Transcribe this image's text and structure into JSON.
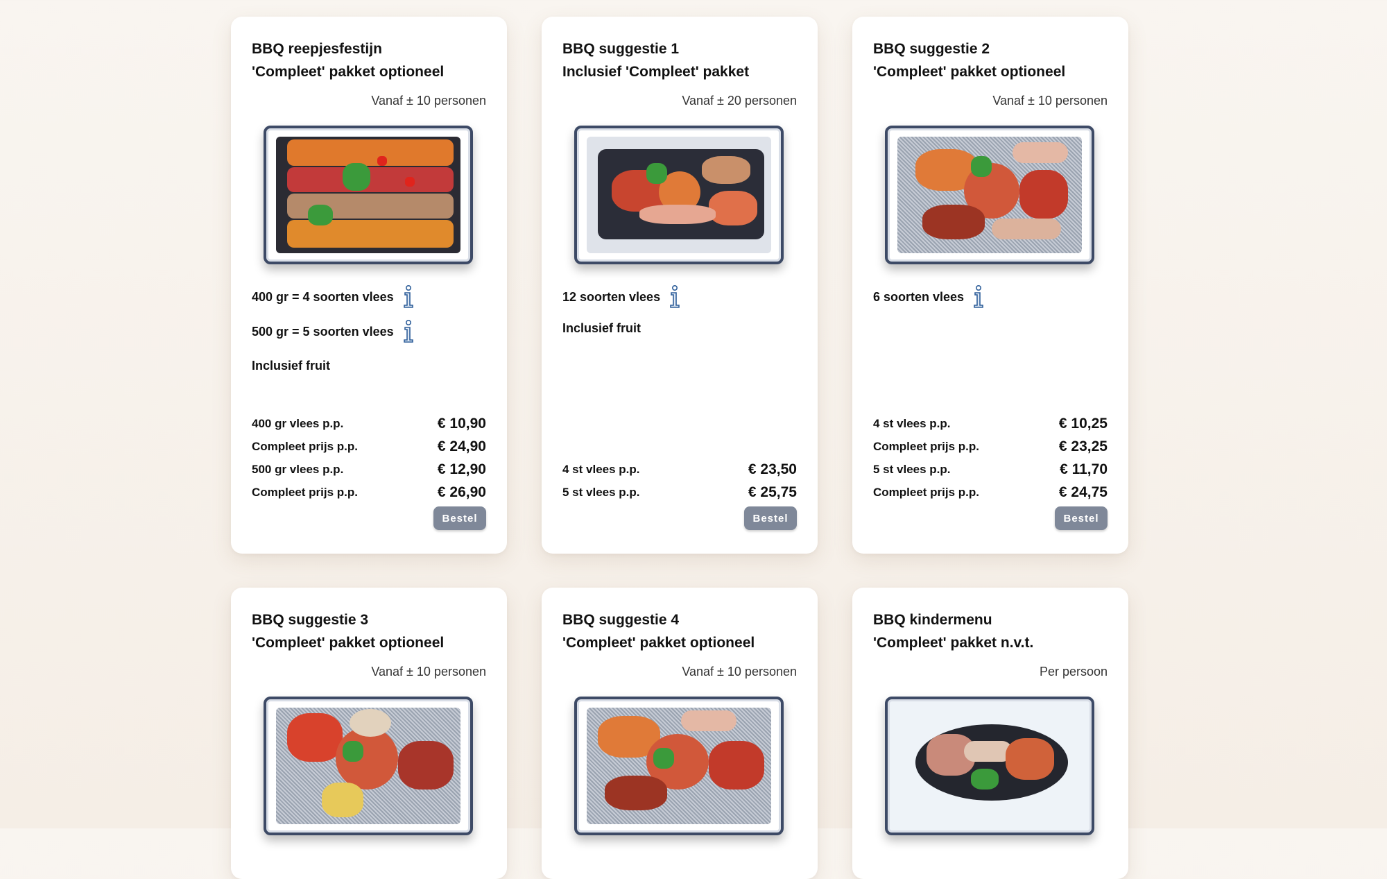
{
  "cards": [
    {
      "title1": "BBQ reepjesfestijn",
      "title2": "'Compleet' pakket optioneel",
      "persons": "Vanaf ± 10 personen",
      "meta": [
        "400 gr = 4 soorten vlees",
        "500 gr = 5 soorten vlees"
      ],
      "fruit": "Inclusief fruit",
      "prices": [
        {
          "label": "400 gr vlees p.p.",
          "value": "€ 10,90"
        },
        {
          "label": "Compleet prijs p.p.",
          "value": "€ 24,90"
        },
        {
          "label": "500 gr vlees p.p.",
          "value": "€ 12,90"
        },
        {
          "label": "Compleet prijs p.p.",
          "value": "€ 26,90"
        }
      ],
      "button": "Bestel"
    },
    {
      "title1": "BBQ suggestie 1",
      "title2": "Inclusief 'Compleet' pakket",
      "persons": "Vanaf ± 20 personen",
      "meta": [
        "12 soorten vlees"
      ],
      "fruit": "Inclusief fruit",
      "prices": [
        {
          "label": "4 st vlees p.p.",
          "value": "€ 23,50"
        },
        {
          "label": "5 st vlees p.p.",
          "value": "€ 25,75"
        }
      ],
      "button": "Bestel"
    },
    {
      "title1": "BBQ suggestie 2",
      "title2": "'Compleet' pakket optioneel",
      "persons": "Vanaf ± 10 personen",
      "meta": [
        "6 soorten vlees"
      ],
      "prices": [
        {
          "label": "4 st vlees p.p.",
          "value": "€ 10,25"
        },
        {
          "label": "Compleet prijs p.p.",
          "value": "€ 23,25"
        },
        {
          "label": "5 st vlees p.p.",
          "value": "€ 11,70"
        },
        {
          "label": "Compleet prijs p.p.",
          "value": "€ 24,75"
        }
      ],
      "button": "Bestel"
    },
    {
      "title1": "BBQ suggestie 3",
      "title2": "'Compleet' pakket optioneel",
      "persons": "Vanaf ± 10 personen"
    },
    {
      "title1": "BBQ suggestie 4",
      "title2": "'Compleet' pakket optioneel",
      "persons": "Vanaf ± 10 personen"
    },
    {
      "title1": "BBQ kindermenu",
      "title2": "'Compleet' pakket n.v.t.",
      "persons": "Per persoon"
    }
  ],
  "colors": {
    "background": "#f7f1ea",
    "button": "#7f8899",
    "info_icon": "#2f5f9a",
    "tray_border": "#3d4a66"
  },
  "icons": {
    "info": "info-icon"
  }
}
